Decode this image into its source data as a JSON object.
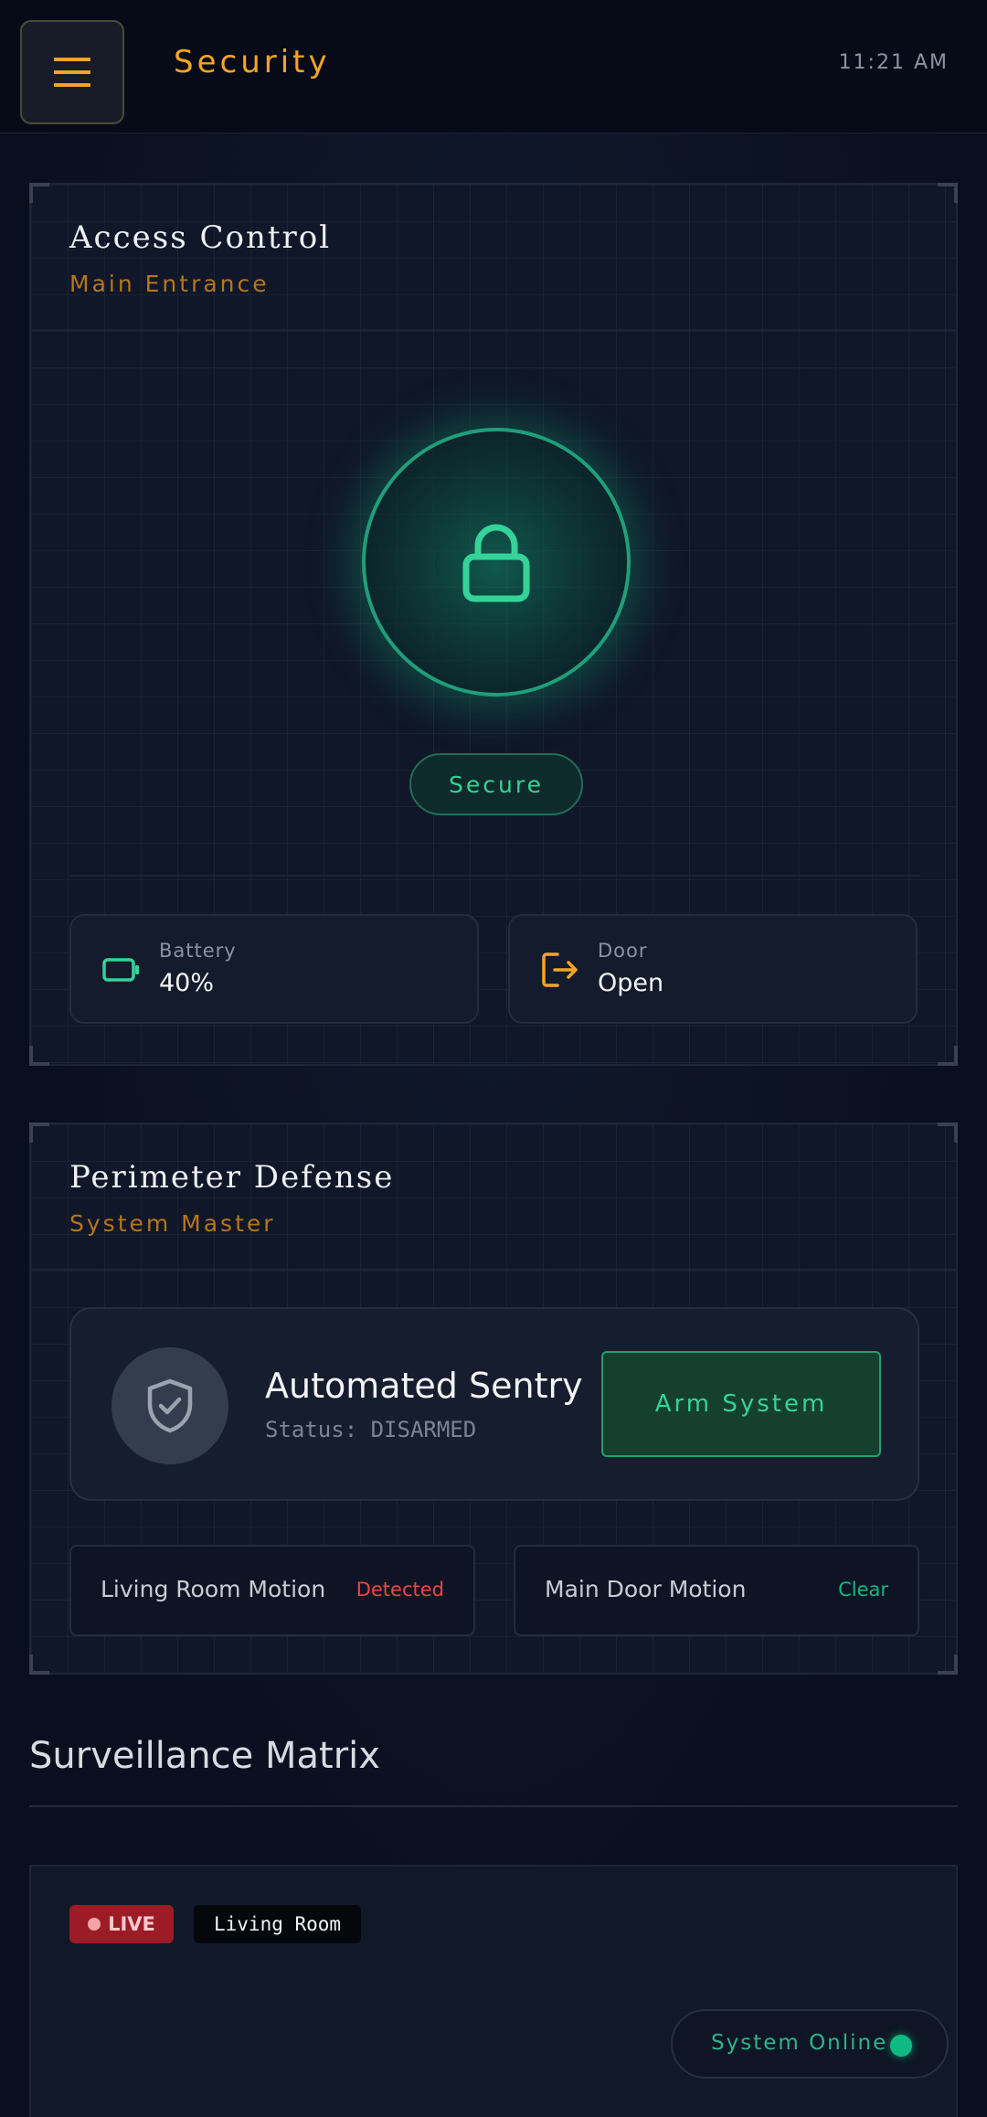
{
  "header": {
    "title": "Security",
    "time": "11:21 AM",
    "accent_color": "#f5a524"
  },
  "access_control": {
    "title": "Access Control",
    "subtitle": "Main Entrance",
    "lock_state": "Secure",
    "lock_icon": "lock-icon",
    "status_color": "#34d399",
    "battery": {
      "label": "Battery",
      "value": "40%",
      "icon": "battery-icon"
    },
    "door": {
      "label": "Door",
      "value": "Open",
      "icon": "door-exit-icon"
    }
  },
  "perimeter": {
    "title": "Perimeter Defense",
    "subtitle": "System Master",
    "sentry": {
      "title": "Automated Sentry",
      "status": "Status: DISARMED",
      "icon": "shield-check-icon",
      "arm_button": "Arm System"
    },
    "motion": [
      {
        "label": "Living Room Motion",
        "state": "Detected",
        "color": "#ef4444"
      },
      {
        "label": "Main Door Motion",
        "state": "Clear",
        "color": "#10b981"
      }
    ]
  },
  "surveillance": {
    "title": "Surveillance Matrix",
    "camera": {
      "live_badge": "LIVE",
      "name": "Living Room",
      "system_status": "System Online"
    }
  }
}
